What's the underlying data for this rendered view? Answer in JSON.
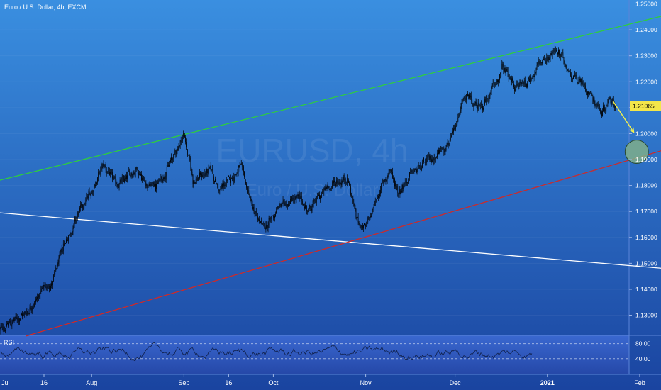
{
  "header": {
    "symbol_title": "Euro / U.S. Dollar, 4h, EXCM",
    "watermark_symbol": "EURUSD, 4h",
    "watermark_name": "Euro / U.S. Dollar"
  },
  "colors": {
    "background_top": "#3a8fe0",
    "background_bottom": "#1a44a0",
    "candle": "#000000",
    "upper_trendline": "#2ecc40",
    "lower_trendline": "#cc2a2a",
    "support_line": "#ffffff",
    "projection_arrow": "#f0f050",
    "target_circle_fill": "#7fae8a",
    "price_label_bg": "#f2e64a",
    "axis_text": "#ffffff",
    "rsi_panel_bg": "#2c52b8"
  },
  "chart_data": {
    "type": "candlestick",
    "timeframe": "4h",
    "instrument": "EURUSD",
    "y_axis": {
      "ylim": [
        1.1225,
        1.2515
      ],
      "ticks": [
        "1.25000",
        "1.24000",
        "1.23000",
        "1.22000",
        "1.21000",
        "1.20000",
        "1.19000",
        "1.18000",
        "1.17000",
        "1.16000",
        "1.15000",
        "1.14000",
        "1.13000"
      ],
      "tick_values": [
        1.25,
        1.24,
        1.23,
        1.22,
        1.21,
        1.2,
        1.19,
        1.18,
        1.17,
        1.16,
        1.15,
        1.14,
        1.13
      ]
    },
    "x_axis": {
      "ticks": [
        "Jul",
        "16",
        "Aug",
        "Sep",
        "16",
        "Oct",
        "Nov",
        "Dec",
        "2021",
        "Feb"
      ],
      "tick_dates": [
        "2020-07-01",
        "2020-07-16",
        "2020-08-01",
        "2020-09-01",
        "2020-09-16",
        "2020-10-01",
        "2020-11-01",
        "2020-12-01",
        "2021-01-01",
        "2021-02-01"
      ]
    },
    "last_price": {
      "label": "1.21065",
      "value": 1.21065
    },
    "price_path": [
      [
        "2020-07-01",
        1.124
      ],
      [
        "2020-07-06",
        1.128
      ],
      [
        "2020-07-10",
        1.131
      ],
      [
        "2020-07-15",
        1.139
      ],
      [
        "2020-07-19",
        1.143
      ],
      [
        "2020-07-23",
        1.158
      ],
      [
        "2020-07-28",
        1.17
      ],
      [
        "2020-08-01",
        1.178
      ],
      [
        "2020-08-05",
        1.188
      ],
      [
        "2020-08-09",
        1.18
      ],
      [
        "2020-08-13",
        1.183
      ],
      [
        "2020-08-16",
        1.187
      ],
      [
        "2020-08-20",
        1.18
      ],
      [
        "2020-08-23",
        1.18
      ],
      [
        "2020-08-28",
        1.19
      ],
      [
        "2020-09-01",
        1.2
      ],
      [
        "2020-09-04",
        1.182
      ],
      [
        "2020-09-10",
        1.186
      ],
      [
        "2020-09-13",
        1.178
      ],
      [
        "2020-09-20",
        1.187
      ],
      [
        "2020-09-25",
        1.168
      ],
      [
        "2020-09-28",
        1.163
      ],
      [
        "2020-10-03",
        1.172
      ],
      [
        "2020-10-08",
        1.176
      ],
      [
        "2020-10-13",
        1.171
      ],
      [
        "2020-10-20",
        1.18
      ],
      [
        "2020-10-26",
        1.183
      ],
      [
        "2020-10-29",
        1.167
      ],
      [
        "2020-11-01",
        1.163
      ],
      [
        "2020-11-05",
        1.176
      ],
      [
        "2020-11-09",
        1.186
      ],
      [
        "2020-11-12",
        1.178
      ],
      [
        "2020-11-17",
        1.185
      ],
      [
        "2020-11-23",
        1.19
      ],
      [
        "2020-11-28",
        1.196
      ],
      [
        "2020-12-01",
        1.2
      ],
      [
        "2020-12-04",
        1.215
      ],
      [
        "2020-12-08",
        1.21
      ],
      [
        "2020-12-12",
        1.213
      ],
      [
        "2020-12-17",
        1.225
      ],
      [
        "2020-12-21",
        1.218
      ],
      [
        "2020-12-25",
        1.22
      ],
      [
        "2020-12-31",
        1.229
      ],
      [
        "2021-01-04",
        1.232
      ],
      [
        "2021-01-08",
        1.225
      ],
      [
        "2021-01-12",
        1.22
      ],
      [
        "2021-01-16",
        1.215
      ],
      [
        "2021-01-19",
        1.208
      ],
      [
        "2021-01-22",
        1.214
      ],
      [
        "2021-01-24",
        1.211
      ]
    ],
    "drawings": {
      "upper_trendline": {
        "from": [
          "2020-07-01",
          1.182
        ],
        "to": [
          "2021-02-25",
          1.25
        ]
      },
      "lower_trendline": {
        "from": [
          "2020-07-10",
          1.122
        ],
        "to": [
          "2021-02-25",
          1.199
        ]
      },
      "support_line": {
        "from": [
          "2020-07-01",
          1.1695
        ],
        "to": [
          "2021-02-25",
          1.1465
        ]
      },
      "projection_arrow": {
        "from": [
          "2021-01-23",
          1.2125
        ],
        "to": [
          "2021-01-30",
          1.2005
        ]
      },
      "target_zone": {
        "center": [
          "2021-01-31",
          1.193
        ],
        "radius_price": 0.0045
      }
    },
    "rsi": {
      "label": "RSI",
      "ticks": [
        "80.00",
        "40.00"
      ],
      "levels": [
        80,
        40
      ],
      "ylim": [
        0,
        100
      ]
    }
  }
}
